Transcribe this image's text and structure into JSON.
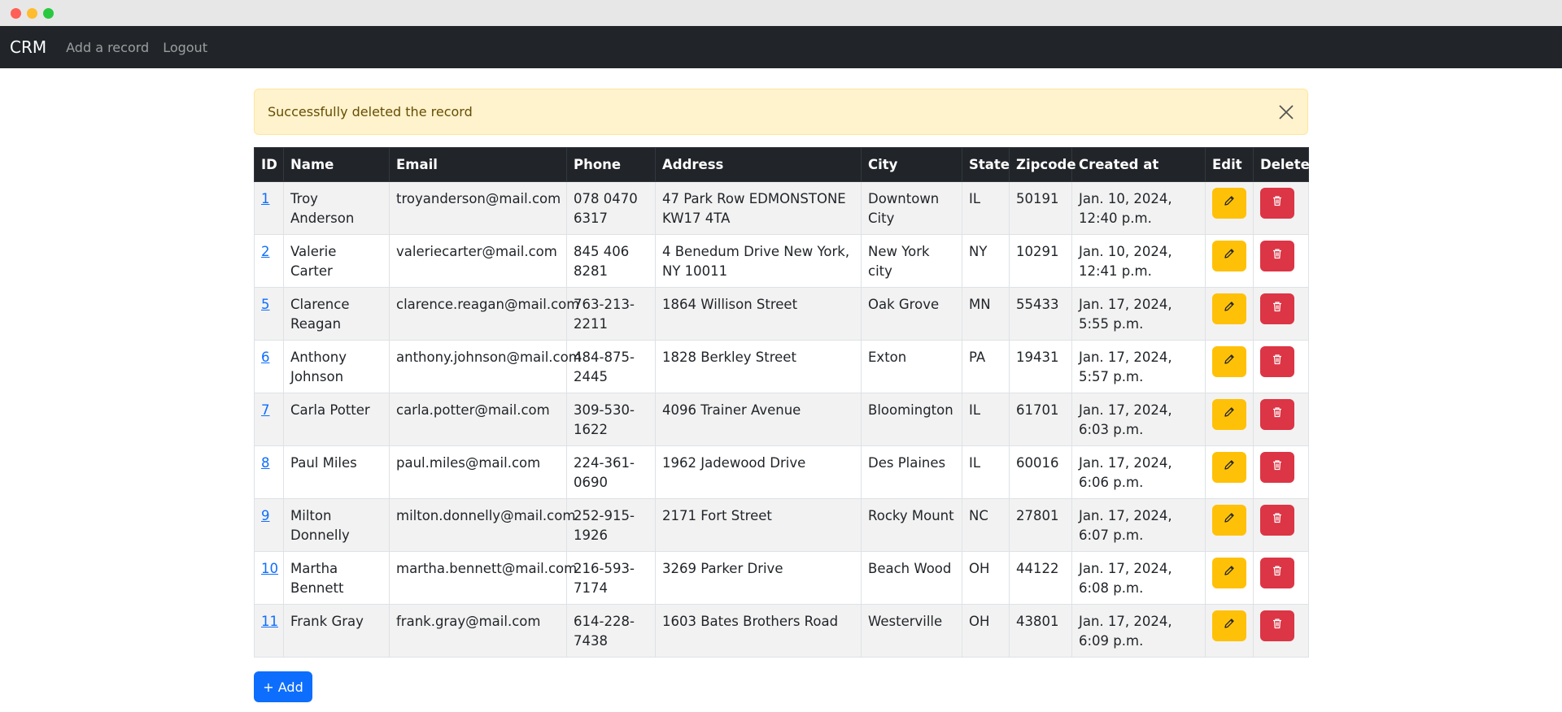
{
  "nav": {
    "brand": "CRM",
    "links": [
      "Add a record",
      "Logout"
    ]
  },
  "alert": {
    "message": "Successfully deleted the record"
  },
  "table": {
    "headers": [
      "ID",
      "Name",
      "Email",
      "Phone",
      "Address",
      "City",
      "State",
      "Zipcode",
      "Created at",
      "Edit",
      "Delete"
    ],
    "rows": [
      {
        "id": "1",
        "name": "Troy Anderson",
        "email": "troyanderson@mail.com",
        "phone": "078 0470 6317",
        "address": "47 Park Row EDMONSTONE KW17 4TA",
        "city": "Downtown City",
        "state": "IL",
        "zipcode": "50191",
        "created": "Jan. 10, 2024, 12:40 p.m."
      },
      {
        "id": "2",
        "name": "Valerie Carter",
        "email": "valeriecarter@mail.com",
        "phone": "845 406 8281",
        "address": "4 Benedum Drive New York, NY 10011",
        "city": "New York city",
        "state": "NY",
        "zipcode": "10291",
        "created": "Jan. 10, 2024, 12:41 p.m."
      },
      {
        "id": "5",
        "name": "Clarence Reagan",
        "email": "clarence.reagan@mail.com",
        "phone": "763-213-2211",
        "address": "1864 Willison Street",
        "city": "Oak Grove",
        "state": "MN",
        "zipcode": "55433",
        "created": "Jan. 17, 2024, 5:55 p.m."
      },
      {
        "id": "6",
        "name": "Anthony Johnson",
        "email": "anthony.johnson@mail.com",
        "phone": "484-875-2445",
        "address": "1828 Berkley Street",
        "city": "Exton",
        "state": "PA",
        "zipcode": "19431",
        "created": "Jan. 17, 2024, 5:57 p.m."
      },
      {
        "id": "7",
        "name": "Carla Potter",
        "email": "carla.potter@mail.com",
        "phone": "309-530-1622",
        "address": "4096 Trainer Avenue",
        "city": "Bloomington",
        "state": "IL",
        "zipcode": "61701",
        "created": "Jan. 17, 2024, 6:03 p.m."
      },
      {
        "id": "8",
        "name": "Paul Miles",
        "email": "paul.miles@mail.com",
        "phone": "224-361-0690",
        "address": "1962 Jadewood Drive",
        "city": "Des Plaines",
        "state": "IL",
        "zipcode": "60016",
        "created": "Jan. 17, 2024, 6:06 p.m."
      },
      {
        "id": "9",
        "name": "Milton Donnelly",
        "email": "milton.donnelly@mail.com",
        "phone": "252-915-1926",
        "address": "2171 Fort Street",
        "city": "Rocky Mount",
        "state": "NC",
        "zipcode": "27801",
        "created": "Jan. 17, 2024, 6:07 p.m."
      },
      {
        "id": "10",
        "name": "Martha Bennett",
        "email": "martha.bennett@mail.com",
        "phone": "216-593-7174",
        "address": "3269 Parker Drive",
        "city": "Beach Wood",
        "state": "OH",
        "zipcode": "44122",
        "created": "Jan. 17, 2024, 6:08 p.m."
      },
      {
        "id": "11",
        "name": "Frank Gray",
        "email": "frank.gray@mail.com",
        "phone": "614-228-7438",
        "address": "1603 Bates Brothers Road",
        "city": "Westerville",
        "state": "OH",
        "zipcode": "43801",
        "created": "Jan. 17, 2024, 6:09 p.m."
      }
    ]
  },
  "add_button": {
    "label": "+ Add"
  },
  "colors": {
    "navbar": "#212529",
    "alert_bg": "#fff3cd",
    "edit": "#ffc107",
    "delete": "#dc3545",
    "primary": "#0d6efd"
  },
  "icons": {
    "edit": "pencil-icon",
    "delete": "trash-icon",
    "close": "close-icon"
  }
}
